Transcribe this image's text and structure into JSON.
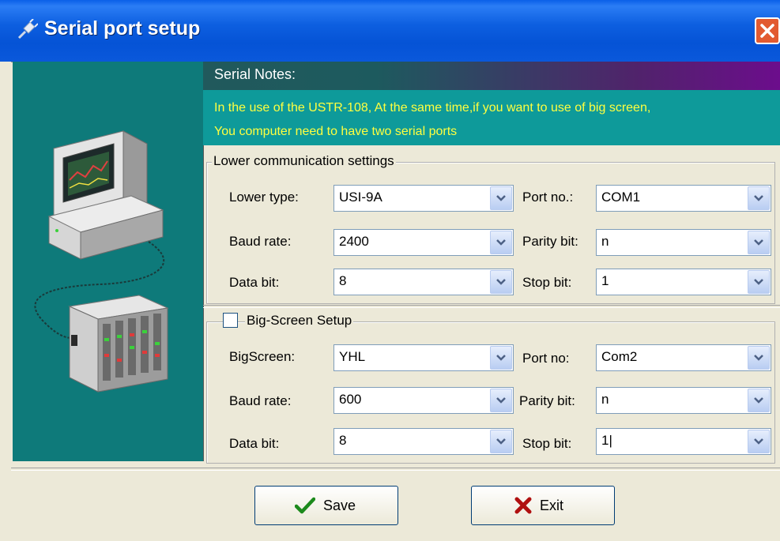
{
  "window": {
    "title": "Serial port setup"
  },
  "notes": {
    "heading": "Serial Notes:",
    "line1": "In the use of the USTR-108, At the same time,if you want to use of big screen,",
    "line2": "You computer need to have two serial ports"
  },
  "lower": {
    "title": "Lower communication settings",
    "lower_type_label": "Lower type:",
    "lower_type_value": "USI-9A",
    "port_label": "Port no.:",
    "port_value": "COM1",
    "baud_label": "Baud rate:",
    "baud_value": "2400",
    "parity_label": "Parity bit:",
    "parity_value": "n",
    "data_label": "Data bit:",
    "data_value": "8",
    "stop_label": "Stop bit:",
    "stop_value": "1"
  },
  "big": {
    "title": "Big-Screen Setup",
    "enabled": false,
    "screen_label": "BigScreen:",
    "screen_value": "YHL",
    "port_label": "Port no:",
    "port_value": "Com2",
    "baud_label": "Baud rate:",
    "baud_value": "600",
    "parity_label": "Parity bit:",
    "parity_value": "n",
    "data_label": "Data bit:",
    "data_value": "8",
    "stop_label": "Stop bit:",
    "stop_value": "1|"
  },
  "buttons": {
    "save": "Save",
    "exit": "Exit"
  },
  "colors": {
    "titlebar": "#0553d6",
    "teal_panel": "#0e7a7a",
    "notes_text": "#ffff40"
  }
}
